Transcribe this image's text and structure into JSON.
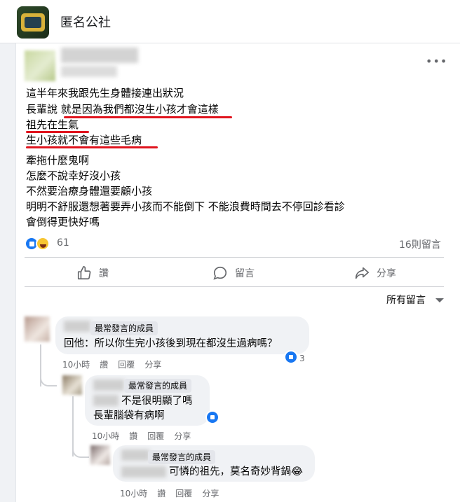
{
  "group": {
    "name": "匿名公社"
  },
  "post": {
    "lines": [
      "這半年來我跟先生身體接連出狀況",
      "長輩說 就是因為我們都沒生小孩才會這樣",
      "祖先在生氣",
      "生小孩就不會有這些毛病",
      "牽拖什麼鬼啊",
      "怎麼不說幸好沒小孩",
      "不然要治療身體還要顧小孩",
      "明明不舒服還想著要弄小孩而不能倒下 不能浪費時間去不停回診看診",
      "會倒得更快好嗎"
    ],
    "reaction_count": "61",
    "comment_count": "16則留言"
  },
  "actions": {
    "like": "讚",
    "comment": "留言",
    "share": "分享"
  },
  "sort": {
    "label": "所有留言"
  },
  "comments": [
    {
      "badge": "最常發言的成員",
      "text_lines": [
        "回他：所以你生完小孩後到現在都沒生過病嗎？"
      ],
      "time": "10小時",
      "like": "讚",
      "reply": "回覆",
      "share": "分享",
      "likes": "3"
    },
    {
      "badge": "最常發言的成員",
      "text_lines": [
        "不是很明顯了嗎",
        "長輩腦袋有病啊"
      ],
      "time": "10小時",
      "like": "讚",
      "reply": "回覆",
      "share": "分享"
    },
    {
      "badge": "最常發言的成員",
      "text_lines": [
        "可憐的祖先，莫名奇妙背鍋😂"
      ],
      "time": "10小時",
      "like": "讚",
      "reply": "回覆",
      "share": "分享"
    }
  ],
  "colors": {
    "underline": "#e0141e",
    "like_blue": "#1877f2"
  }
}
